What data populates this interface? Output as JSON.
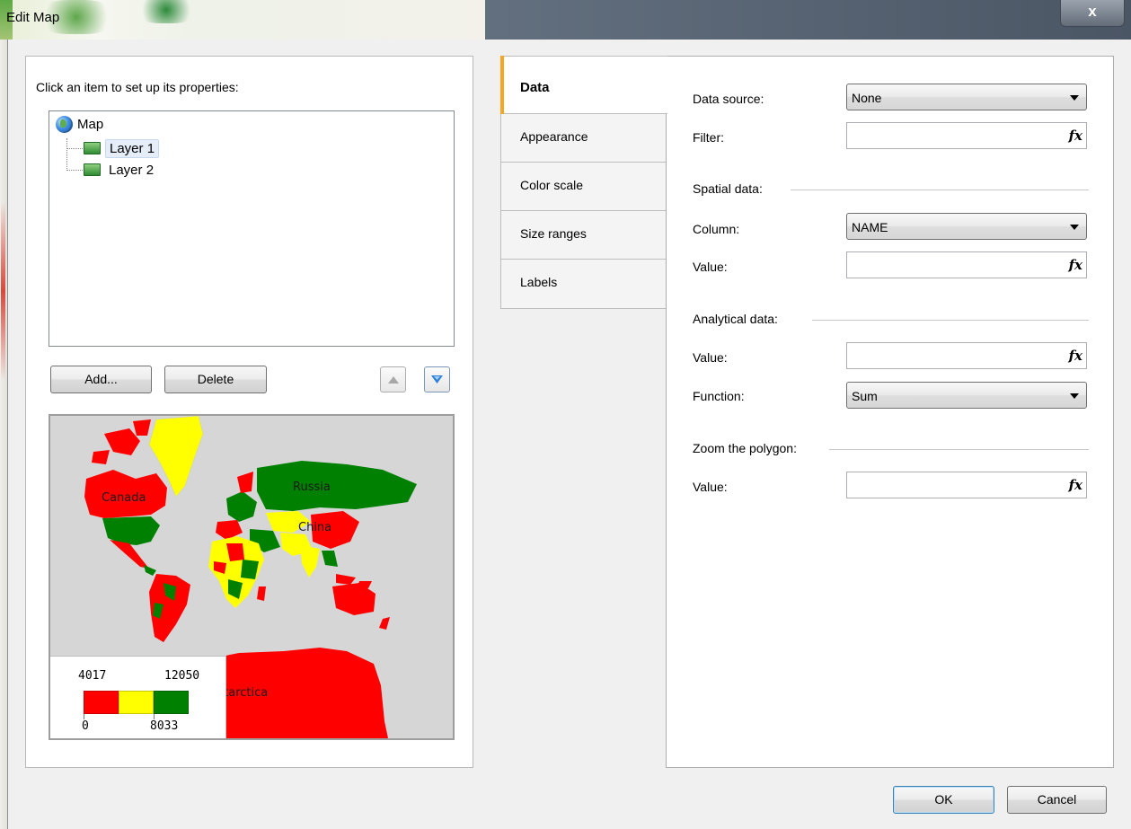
{
  "window": {
    "title": "Edit Map",
    "close_glyph": "x"
  },
  "left": {
    "instruction": "Click an item to set up its properties:",
    "tree": [
      {
        "label": "Map",
        "icon": "globe-icon"
      },
      {
        "label": "Layer 1",
        "icon": "layer-icon",
        "selected": true
      },
      {
        "label": "Layer 2",
        "icon": "layer-icon",
        "selected": false
      }
    ],
    "buttons": {
      "add": "Add...",
      "delete": "Delete"
    },
    "move_up_icon": "arrow-up-icon",
    "move_down_icon": "arrow-down-icon"
  },
  "preview": {
    "labels": {
      "canada": "Canada",
      "russia": "Russia",
      "china": "China",
      "antarctica": "Antarctica"
    },
    "colors": {
      "low": "#ff0000",
      "mid": "#ffff00",
      "high": "#008000",
      "background": "#d6d6d6"
    },
    "legend": {
      "top_left": "4017",
      "top_right": "12050",
      "bottom_left": "0",
      "bottom_mid": "8033"
    }
  },
  "tabs": [
    {
      "label": "Data",
      "active": true
    },
    {
      "label": "Appearance",
      "active": false
    },
    {
      "label": "Color scale",
      "active": false
    },
    {
      "label": "Size ranges",
      "active": false
    },
    {
      "label": "Labels",
      "active": false
    }
  ],
  "data_tab": {
    "data_source_label": "Data source:",
    "data_source_value": "None",
    "filter_label": "Filter:",
    "filter_value": "",
    "spatial_header": "Spatial data:",
    "column_label": "Column:",
    "column_value": "NAME",
    "spatial_value_label": "Value:",
    "spatial_value": "",
    "analytical_header": "Analytical data:",
    "analytical_value_label": "Value:",
    "analytical_value": "",
    "function_label": "Function:",
    "function_value": "Sum",
    "zoom_header": "Zoom the polygon:",
    "zoom_value_label": "Value:",
    "zoom_value": "",
    "fx_glyph": "fx"
  },
  "footer": {
    "ok": "OK",
    "cancel": "Cancel"
  }
}
